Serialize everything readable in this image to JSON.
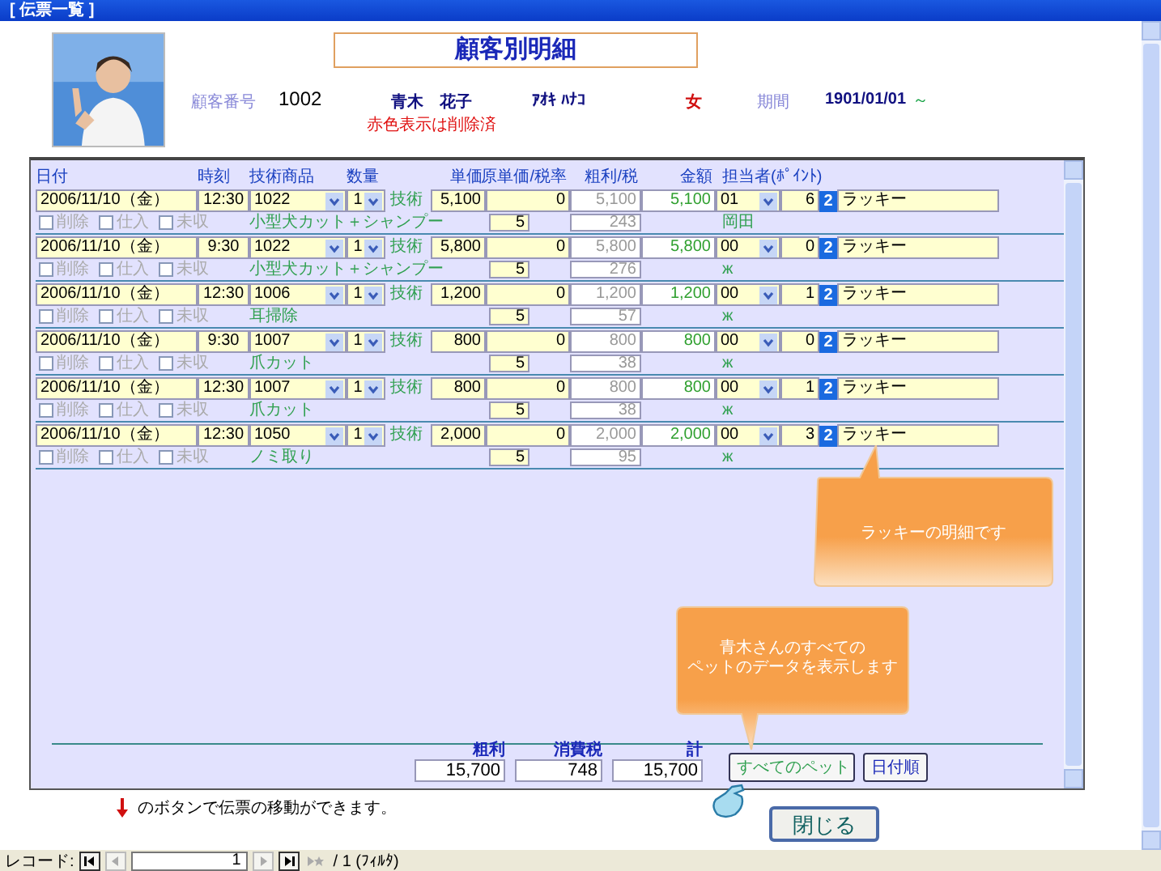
{
  "window": {
    "title": "[ 伝票一覧 ]"
  },
  "form_title": "顧客別明細",
  "customer": {
    "number_label": "顧客番号",
    "number": "1002",
    "name": "青木　花子",
    "note": "赤色表示は削除済",
    "kana": "ｱｵｷ ﾊﾅｺ",
    "gender": "女",
    "period_label": "期間",
    "period": "1901/01/01",
    "period_mark": "～"
  },
  "columns": [
    "日付",
    "時刻",
    "技術商品",
    "数量",
    "単価",
    "原単価/税率",
    "粗利/税",
    "金額",
    "担当者(ﾎﾟｲﾝﾄ)"
  ],
  "rows": [
    {
      "date": "2006/11/10（金）",
      "time": "12:30",
      "code": "1022",
      "qty": "1",
      "type": "技術",
      "unit_price": "5,100",
      "orig_price": "0",
      "profit": "5,100",
      "amount": "5,100",
      "staff_code": "01",
      "points": "6",
      "rank": "2",
      "pet": "ラッキー",
      "flags": [
        {
          "label": "削除",
          "checked": false
        },
        {
          "label": "仕入",
          "checked": false
        },
        {
          "label": "未収",
          "checked": false
        }
      ],
      "item": "小型犬カット＋シャンプー",
      "tax_rate": "5",
      "tax": "243",
      "staff_name": "岡田"
    },
    {
      "date": "2006/11/10（金）",
      "time": "9:30",
      "code": "1022",
      "qty": "1",
      "type": "技術",
      "unit_price": "5,800",
      "orig_price": "0",
      "profit": "5,800",
      "amount": "5,800",
      "staff_code": "00",
      "points": "0",
      "rank": "2",
      "pet": "ラッキー",
      "flags": [
        {
          "label": "削除",
          "checked": false
        },
        {
          "label": "仕入",
          "checked": false
        },
        {
          "label": "未収",
          "checked": false
        }
      ],
      "item": "小型犬カット＋シャンプー",
      "tax_rate": "5",
      "tax": "276",
      "staff_name": "ж"
    },
    {
      "date": "2006/11/10（金）",
      "time": "12:30",
      "code": "1006",
      "qty": "1",
      "type": "技術",
      "unit_price": "1,200",
      "orig_price": "0",
      "profit": "1,200",
      "amount": "1,200",
      "staff_code": "00",
      "points": "1",
      "rank": "2",
      "pet": "ラッキー",
      "flags": [
        {
          "label": "削除",
          "checked": false
        },
        {
          "label": "仕入",
          "checked": false
        },
        {
          "label": "未収",
          "checked": false
        }
      ],
      "item": "耳掃除",
      "tax_rate": "5",
      "tax": "57",
      "staff_name": "ж"
    },
    {
      "date": "2006/11/10（金）",
      "time": "9:30",
      "code": "1007",
      "qty": "1",
      "type": "技術",
      "unit_price": "800",
      "orig_price": "0",
      "profit": "800",
      "amount": "800",
      "staff_code": "00",
      "points": "0",
      "rank": "2",
      "pet": "ラッキー",
      "flags": [
        {
          "label": "削除",
          "checked": false
        },
        {
          "label": "仕入",
          "checked": false
        },
        {
          "label": "未収",
          "checked": false
        }
      ],
      "item": "爪カット",
      "tax_rate": "5",
      "tax": "38",
      "staff_name": "ж"
    },
    {
      "date": "2006/11/10（金）",
      "time": "12:30",
      "code": "1007",
      "qty": "1",
      "type": "技術",
      "unit_price": "800",
      "orig_price": "0",
      "profit": "800",
      "amount": "800",
      "staff_code": "00",
      "points": "1",
      "rank": "2",
      "pet": "ラッキー",
      "flags": [
        {
          "label": "削除",
          "checked": false
        },
        {
          "label": "仕入",
          "checked": false
        },
        {
          "label": "未収",
          "checked": false
        }
      ],
      "item": "爪カット",
      "tax_rate": "5",
      "tax": "38",
      "staff_name": "ж"
    },
    {
      "date": "2006/11/10（金）",
      "time": "12:30",
      "code": "1050",
      "qty": "1",
      "type": "技術",
      "unit_price": "2,000",
      "orig_price": "0",
      "profit": "2,000",
      "amount": "2,000",
      "staff_code": "00",
      "points": "3",
      "rank": "2",
      "pet": "ラッキー",
      "flags": [
        {
          "label": "削除",
          "checked": false
        },
        {
          "label": "仕入",
          "checked": false
        },
        {
          "label": "未収",
          "checked": false
        }
      ],
      "item": "ノミ取り",
      "tax_rate": "5",
      "tax": "95",
      "staff_name": "ж"
    }
  ],
  "totals": [
    {
      "label": "粗利",
      "value": "15,700"
    },
    {
      "label": "消費税",
      "value": "748"
    },
    {
      "label": "計",
      "value": "15,700"
    }
  ],
  "buttons": [
    "すべてのペット",
    "日付順"
  ],
  "callouts": [
    {
      "kind": "up",
      "lines": [
        "ラッキーの明細です"
      ]
    },
    {
      "kind": "down",
      "lines": [
        "青木さんのすべての",
        "ペットのデータを表示します"
      ]
    }
  ],
  "hint": "のボタンで伝票の移動ができます。",
  "close_button": "閉じる",
  "record_nav": {
    "label": "レコード:",
    "current": "1",
    "total": "/ 1 (ﾌｨﾙﾀ)"
  }
}
